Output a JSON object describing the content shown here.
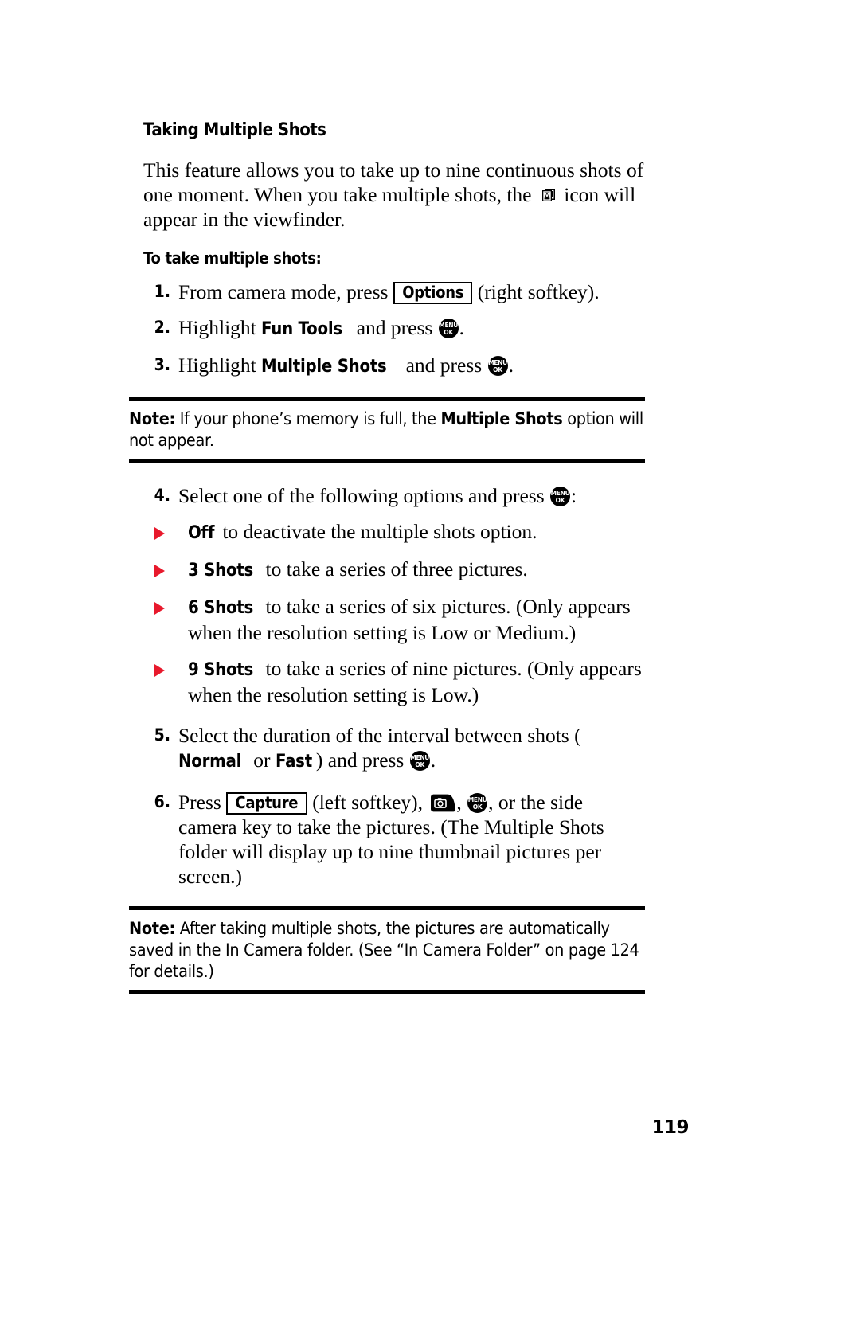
{
  "document": {
    "section_title": "Taking Multiple Shots",
    "intro": {
      "before_icon": "This feature allows you to take up to nine continuous shots of one moment. When you take multiple shots, the",
      "icon_name": "multiple-shots-viewfinder-icon",
      "after_icon": "icon will appear in the viewfinder."
    },
    "sub_title": "To take multiple shots:",
    "steps": [
      {
        "number": "1.",
        "text_before": "From camera mode, press",
        "softkey": "Options",
        "text_after": "(right softkey)."
      },
      {
        "number": "2.",
        "text_before": "Highlight",
        "bold_term": "Fun Tools",
        "text_mid": "and press",
        "text_after": "."
      },
      {
        "number": "3.",
        "text_before": "Highlight",
        "bold_term": "Multiple Shots",
        "text_mid": "and press",
        "text_after": "."
      },
      {
        "number": "4.",
        "text_before": "Select one of the following options and press",
        "text_after": ":"
      },
      {
        "number": "5.",
        "text_before": "Select the duration of the interval between shots (",
        "bold_term": "Normal",
        "text_mid": "or",
        "bold_term_2": "Fast",
        "text_mid_2": ") and press",
        "text_after": "."
      },
      {
        "number": "6.",
        "text_before": "Press",
        "softkey": "Capture",
        "text_mid": "(left softkey),",
        "text_mid_2": ",",
        "text_after": ", or the side camera key to take the pictures. (The Multiple Shots folder will display up to nine thumbnail pictures per screen.)"
      }
    ],
    "bullets": [
      {
        "bold_term": "Off",
        "text": "to deactivate the multiple shots option."
      },
      {
        "bold_term": "3 Shots",
        "text": "to take a series of three pictures."
      },
      {
        "bold_term": "6 Shots",
        "text": "to take a series of six pictures. (Only appears when the resolution setting is Low or Medium.)"
      },
      {
        "bold_term": "9 Shots",
        "text": "to take a series of nine pictures. (Only appears when the resolution setting is Low.)"
      }
    ],
    "notes": [
      {
        "label": "Note:",
        "text_before": "If your phone’s memory is full, the",
        "bold_term": "Multiple Shots",
        "text_after": "option will not appear."
      },
      {
        "label": "Note:",
        "text_before": "After taking multiple shots, the pictures are automatically saved in the In Camera folder. (See “In Camera Folder” on page 124 for details.)",
        "bold_term": "",
        "text_after": ""
      }
    ],
    "page_number": "119",
    "glyphs": {
      "menu_key_top": "MENU",
      "menu_key_bottom": "OK",
      "camera_key_name": "side-camera-key-icon"
    },
    "colors": {
      "bullet_red": "#e8192c",
      "text_black": "#000000",
      "background": "#ffffff"
    }
  }
}
